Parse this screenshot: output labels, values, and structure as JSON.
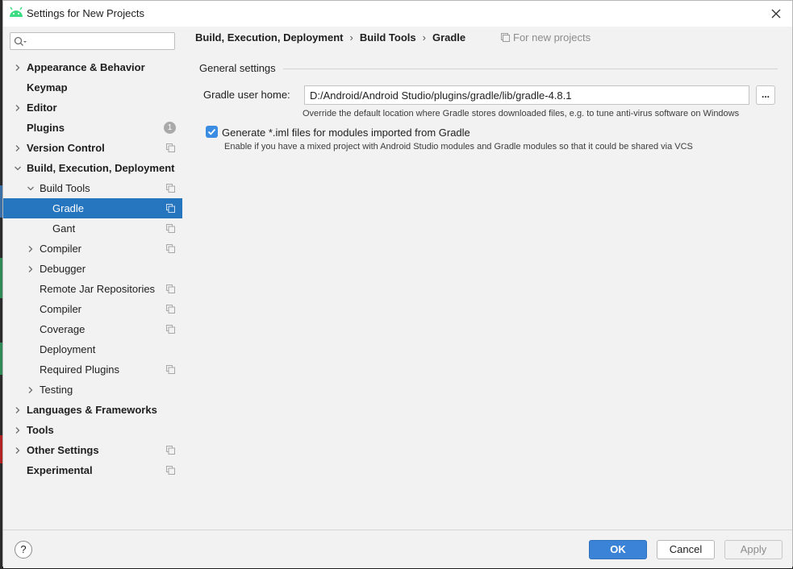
{
  "window": {
    "title": "Settings for New Projects"
  },
  "sidebar": {
    "search": {
      "value": "",
      "placeholder": ""
    },
    "items": [
      {
        "label": "Appearance & Behavior",
        "level": 0,
        "bold": true,
        "expandable": true,
        "expanded": false,
        "project_icon": false
      },
      {
        "label": "Keymap",
        "level": 0,
        "bold": true,
        "expandable": false,
        "project_icon": false
      },
      {
        "label": "Editor",
        "level": 0,
        "bold": true,
        "expandable": true,
        "expanded": false,
        "project_icon": false
      },
      {
        "label": "Plugins",
        "level": 0,
        "bold": true,
        "expandable": false,
        "project_icon": false,
        "badge": "1"
      },
      {
        "label": "Version Control",
        "level": 0,
        "bold": true,
        "expandable": true,
        "expanded": false,
        "project_icon": true
      },
      {
        "label": "Build, Execution, Deployment",
        "level": 0,
        "bold": true,
        "expandable": true,
        "expanded": true,
        "project_icon": false
      },
      {
        "label": "Build Tools",
        "level": 1,
        "bold": false,
        "expandable": true,
        "expanded": true,
        "project_icon": true
      },
      {
        "label": "Gradle",
        "level": 2,
        "bold": false,
        "expandable": false,
        "project_icon": true,
        "selected": true
      },
      {
        "label": "Gant",
        "level": 2,
        "bold": false,
        "expandable": false,
        "project_icon": true
      },
      {
        "label": "Compiler",
        "level": 1,
        "bold": false,
        "expandable": true,
        "expanded": false,
        "project_icon": true
      },
      {
        "label": "Debugger",
        "level": 1,
        "bold": false,
        "expandable": true,
        "expanded": false,
        "project_icon": false
      },
      {
        "label": "Remote Jar Repositories",
        "level": 1,
        "bold": false,
        "expandable": false,
        "project_icon": true
      },
      {
        "label": "Compiler",
        "level": 1,
        "bold": false,
        "expandable": false,
        "project_icon": true
      },
      {
        "label": "Coverage",
        "level": 1,
        "bold": false,
        "expandable": false,
        "project_icon": true
      },
      {
        "label": "Deployment",
        "level": 1,
        "bold": false,
        "expandable": false,
        "project_icon": false
      },
      {
        "label": "Required Plugins",
        "level": 1,
        "bold": false,
        "expandable": false,
        "project_icon": true
      },
      {
        "label": "Testing",
        "level": 1,
        "bold": false,
        "expandable": true,
        "expanded": false,
        "project_icon": false
      },
      {
        "label": "Languages & Frameworks",
        "level": 0,
        "bold": true,
        "expandable": true,
        "expanded": false,
        "project_icon": false
      },
      {
        "label": "Tools",
        "level": 0,
        "bold": true,
        "expandable": true,
        "expanded": false,
        "project_icon": false
      },
      {
        "label": "Other Settings",
        "level": 0,
        "bold": true,
        "expandable": true,
        "expanded": false,
        "project_icon": true
      },
      {
        "label": "Experimental",
        "level": 0,
        "bold": true,
        "expandable": false,
        "project_icon": true
      }
    ]
  },
  "main": {
    "breadcrumb": [
      "Build, Execution, Deployment",
      "Build Tools",
      "Gradle"
    ],
    "breadcrumb_separator": "›",
    "scope_label": "For new projects",
    "section_title": "General settings",
    "gradle_home": {
      "label": "Gradle user home:",
      "value": "D:/Android/Android Studio/plugins/gradle/lib/gradle-4.8.1",
      "browse_label": "...",
      "hint": "Override the default location where Gradle stores downloaded files, e.g. to tune anti-virus software on Windows"
    },
    "generate_iml": {
      "checked": true,
      "label": "Generate *.iml files for modules imported from Gradle",
      "hint": "Enable if you have a mixed project with Android Studio modules and Gradle modules so that it could be shared via VCS"
    }
  },
  "footer": {
    "help_label": "?",
    "ok_label": "OK",
    "cancel_label": "Cancel",
    "apply_label": "Apply"
  },
  "colors": {
    "selection": "#2675bf",
    "ok_button": "#3b83d6",
    "checkbox": "#3b8de4",
    "android_green": "#3ddc84"
  }
}
